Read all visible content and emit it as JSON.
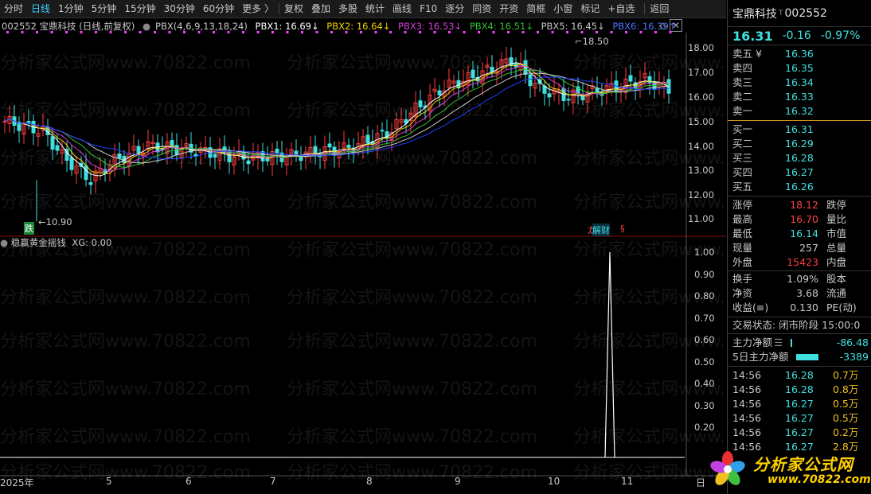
{
  "toolbar": {
    "items": [
      "分时",
      "日线",
      "1分钟",
      "5分钟",
      "15分钟",
      "30分钟",
      "60分钟",
      "更多 〉",
      "复权",
      "叠加",
      "多股",
      "统计",
      "画线",
      "F10",
      "逐分",
      "同资",
      "开资",
      "简框",
      "小窗",
      "标记",
      "+自选",
      "返回"
    ],
    "active": "日线"
  },
  "chart_title": {
    "code_name": "002552 宝鼎科技 (日线,前复权)",
    "pbx_name": "PBX(4,6,9,13,18,24)",
    "pbx1": "PBX1: 16.69↓",
    "pbx2": "PBX2: 16.64↓",
    "pbx3": "PBX3: 16.53↓",
    "pbx4": "PBX4: 16.51↓",
    "pbx5": "PBX5: 16.45↓",
    "pbx6": "PBX6: 16.39↑"
  },
  "colors": {
    "pbx1": "#ffffff",
    "pbx2": "#f0d000",
    "pbx3": "#d040d0",
    "pbx4": "#30c030",
    "pbx5": "#c8c8c8",
    "pbx6": "#2040ff",
    "up": "#ff3c3c",
    "down": "#40e0e0"
  },
  "price_axis": [
    "18.00",
    "17.00",
    "16.00",
    "15.00",
    "14.00",
    "13.00",
    "12.00",
    "11.00"
  ],
  "annotations": {
    "high": "18.50",
    "low": "10.90",
    "fall": "跌",
    "tag1": "龙榜",
    "tag2": "解财"
  },
  "indicator": {
    "title": "稳赢黄金摇钱",
    "xg": "XG: 0.00",
    "axis": [
      "1.00",
      "0.90",
      "0.80",
      "0.70",
      "0.60",
      "0.50",
      "0.40",
      "0.30",
      "0.20"
    ]
  },
  "date_axis": [
    "2025年",
    "5",
    "6",
    "7",
    "8",
    "9",
    "10",
    "11",
    "日"
  ],
  "watermark_text": "分析家公式网www.70822.com",
  "right_panel": {
    "name": "宝鼎科技",
    "code": "002552",
    "price": "16.31",
    "change": "-0.16",
    "pct": "-0.97%",
    "sells": [
      [
        "卖五 ¥",
        "16.36"
      ],
      [
        "卖四",
        "16.35"
      ],
      [
        "卖三",
        "16.34"
      ],
      [
        "卖二",
        "16.33"
      ],
      [
        "卖一",
        "16.32"
      ]
    ],
    "buys": [
      [
        "买一",
        "16.31"
      ],
      [
        "买二",
        "16.29"
      ],
      [
        "买三",
        "16.28"
      ],
      [
        "买四",
        "16.27"
      ],
      [
        "买五",
        "16.26"
      ]
    ],
    "stats": [
      [
        "涨停",
        "18.12",
        "跌停"
      ],
      [
        "最高",
        "16.70",
        "量比"
      ],
      [
        "最低",
        "16.14",
        "市值"
      ],
      [
        "现量",
        "257",
        "总量"
      ],
      [
        "外盘",
        "15423",
        "内盘"
      ],
      [
        "换手",
        "1.09%",
        "股本"
      ],
      [
        "净资",
        "3.68",
        "流通"
      ],
      [
        "收益(≡)",
        "0.130",
        "PE(动)"
      ]
    ],
    "trade_status": "交易状态: 闭市阶段 15:00:0",
    "main_flow_label": "主力净额",
    "main_flow_value": "-86.48",
    "main_flow5_label": "5日主力净额",
    "main_flow5_value": "-3389",
    "ticks": [
      [
        "14:56",
        "16.28",
        "0.7万"
      ],
      [
        "14:56",
        "16.28",
        "0.8万"
      ],
      [
        "14:56",
        "16.27",
        "0.5万"
      ],
      [
        "14:56",
        "16.27",
        "0.5万"
      ],
      [
        "14:56",
        "16.27",
        "0.2万"
      ],
      [
        "14:56",
        "16.27",
        "2.8万"
      ]
    ]
  },
  "logo": {
    "text": "分析家公式网",
    "url": "www.70822.com"
  }
}
